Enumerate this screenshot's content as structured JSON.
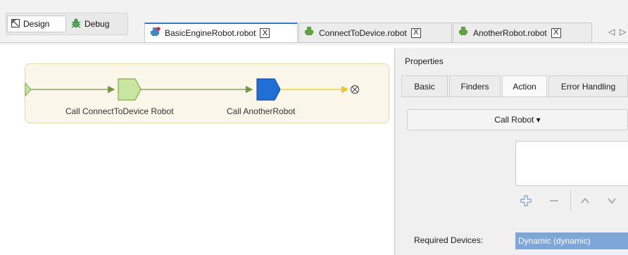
{
  "modes": {
    "design": {
      "label": "Design",
      "icon": "design-mode-icon"
    },
    "debug": {
      "label": "Debug",
      "icon": "debug-bug-icon"
    }
  },
  "tabs": [
    {
      "label": "BasicEngineRobot.robot",
      "icon": "robot-icon",
      "active": true,
      "close": "X"
    },
    {
      "label": "ConnectToDevice.robot",
      "icon": "robot-icon",
      "active": false,
      "close": "X"
    },
    {
      "label": "AnotherRobot.robot",
      "icon": "robot-icon",
      "active": false,
      "close": "X"
    }
  ],
  "tab_scroll_left": "◁",
  "tab_scroll_right": "▷",
  "flow": {
    "steps": [
      {
        "label": "Call ConnectToDevice Robot",
        "color": "#c8e6a0",
        "stroke": "#7fae4d"
      },
      {
        "label": "Call AnotherRobot",
        "color": "#1f6fd6",
        "stroke": "#174f9e"
      }
    ],
    "colors": {
      "edge": "#6e9a3c",
      "edge_end": "#f2c230",
      "end_node": "#555555"
    }
  },
  "properties": {
    "title": "Properties",
    "tabs": [
      "Basic",
      "Finders",
      "Action",
      "Error Handling"
    ],
    "active_tab": "Action",
    "action_button": "Call Robot ▾",
    "toolbar_icons": [
      "add-icon",
      "remove-icon",
      "move-up-icon",
      "move-down-icon"
    ],
    "required_devices_label": "Required Devices:",
    "required_devices_value": "Dynamic (dynamic)"
  }
}
